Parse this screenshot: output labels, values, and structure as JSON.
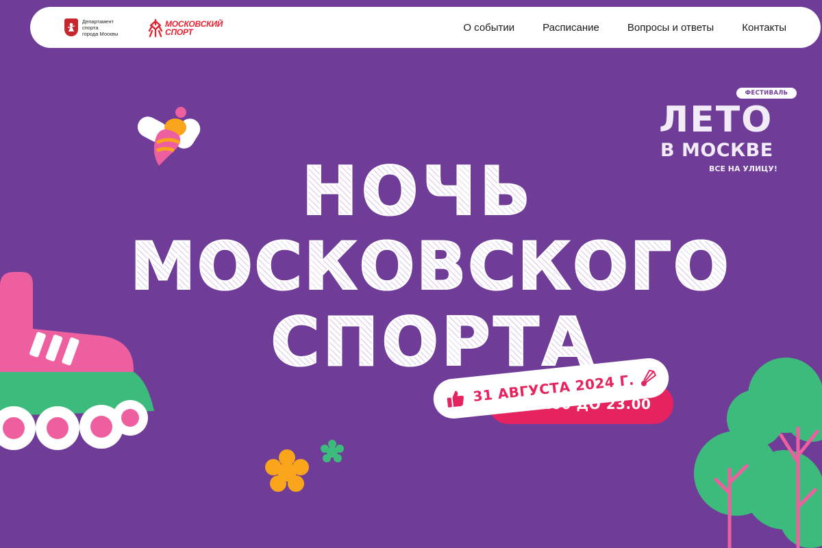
{
  "header": {
    "department": {
      "line1": "Департамент",
      "line2": "спорта",
      "line3": "города Москвы"
    },
    "brand": {
      "line1": "МОСКОВСКИЙ",
      "line2": "СПОРТ"
    },
    "nav": [
      {
        "label": "О событии"
      },
      {
        "label": "Расписание"
      },
      {
        "label": "Вопросы и ответы"
      },
      {
        "label": "Контакты"
      }
    ]
  },
  "festival": {
    "tag": "ФЕСТИВАЛЬ",
    "name_line1": "ЛЕТО",
    "name_line2": "В МОСКВЕ",
    "slogan": "ВСЕ НА УЛИЦУ!"
  },
  "hero": {
    "title_line1": "НОЧЬ",
    "title_line2": "МОСКОВСКОГО",
    "title_line3": "СПОРТА",
    "date": "31 АВГУСТА 2024 Г.",
    "time": "С 20.00 ДО 23.00"
  },
  "colors": {
    "background": "#6f3d97",
    "accent_pink": "#e4235f",
    "brand_red": "#e62330",
    "skate_pink": "#ee5fa0",
    "tree_green": "#3dbb7c",
    "flower_yellow": "#f8a51c"
  },
  "icons": {
    "thumb": "thumbs-up-icon",
    "shuttle": "shuttlecock-icon",
    "bee": "bee-icon",
    "skate": "roller-skate-icon",
    "tree": "tree-icon",
    "flower": "flower-icon"
  }
}
